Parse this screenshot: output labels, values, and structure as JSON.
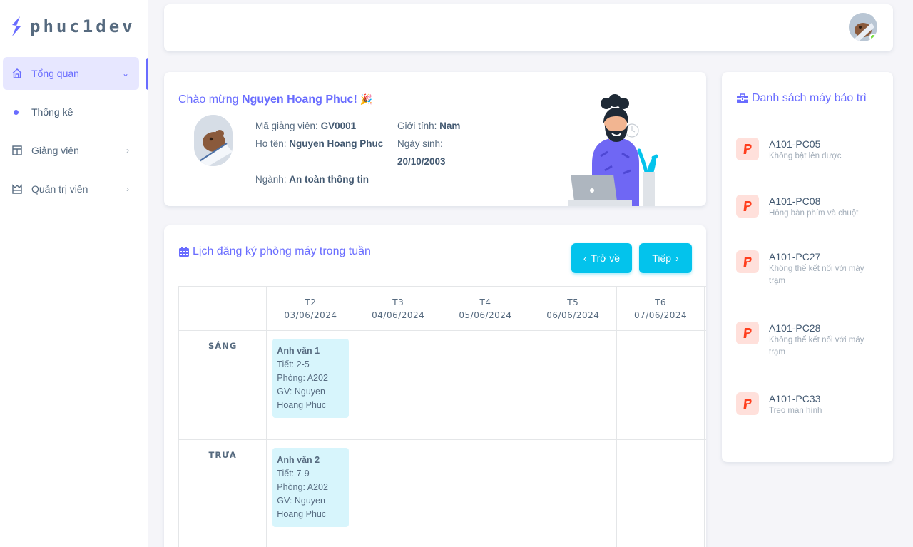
{
  "brand": {
    "name": "phuc1dev"
  },
  "sidebar": {
    "items": [
      {
        "label": "Tổng quan",
        "icon": "home-icon",
        "active": true,
        "chevron": "⌄"
      },
      {
        "label": "Thống kê",
        "sub": true
      },
      {
        "label": "Giảng viên",
        "icon": "layout-icon",
        "chevron": "›"
      },
      {
        "label": "Quản trị viên",
        "icon": "crown-icon",
        "chevron": "›"
      }
    ]
  },
  "welcome": {
    "greeting_prefix": "Chào mừng ",
    "name": "Nguyen Hoang Phuc!",
    "party": "🎉",
    "magv_label": "Mã giảng viên: ",
    "magv_value": "GV0001",
    "hoten_label": "Họ tên: ",
    "hoten_value": "Nguyen Hoang Phuc",
    "nganh_label": "Ngành: ",
    "nganh_value": "An toàn thông tin",
    "gioitinh_label": "Giới tính: ",
    "gioitinh_value": "Nam",
    "ngaysinh_label": "Ngày sinh:",
    "ngaysinh_value": "20/10/2003"
  },
  "maintenance": {
    "title": "Danh sách máy bảo trì",
    "items": [
      {
        "code": "A101-PC05",
        "desc": "Không bật lên được"
      },
      {
        "code": "A101-PC08",
        "desc": "Hỏng bàn phím và chuột"
      },
      {
        "code": "A101-PC27",
        "desc": "Không thể kết nối với máy trạm"
      },
      {
        "code": "A101-PC28",
        "desc": "Không thể kết nối với máy trạm"
      },
      {
        "code": "A101-PC33",
        "desc": "Treo màn hình"
      }
    ]
  },
  "schedule": {
    "title": "Lịch đăng ký phòng máy trong tuần",
    "back_label": "Trở về",
    "next_label": "Tiếp",
    "days": [
      {
        "day": "T2",
        "date": "03/06/2024"
      },
      {
        "day": "T3",
        "date": "04/06/2024"
      },
      {
        "day": "T4",
        "date": "05/06/2024"
      },
      {
        "day": "T5",
        "date": "06/06/2024"
      },
      {
        "day": "T6",
        "date": "07/06/2024"
      },
      {
        "day": "",
        "date": "("
      }
    ],
    "sessions": [
      {
        "label": "SÁNG",
        "event": {
          "name": "Anh văn 1",
          "tiet": "Tiết: 2-5",
          "phong": "Phòng: A202",
          "gv": "GV: Nguyen Hoang Phuc"
        }
      },
      {
        "label": "TRƯA",
        "event": {
          "name": "Anh văn 2",
          "tiet": "Tiết: 7-9",
          "phong": "Phòng: A202",
          "gv": "GV: Nguyen Hoang Phuc"
        }
      }
    ]
  },
  "colors": {
    "primary": "#696cff",
    "info": "#03c3ec",
    "danger": "#ff3e1d"
  }
}
